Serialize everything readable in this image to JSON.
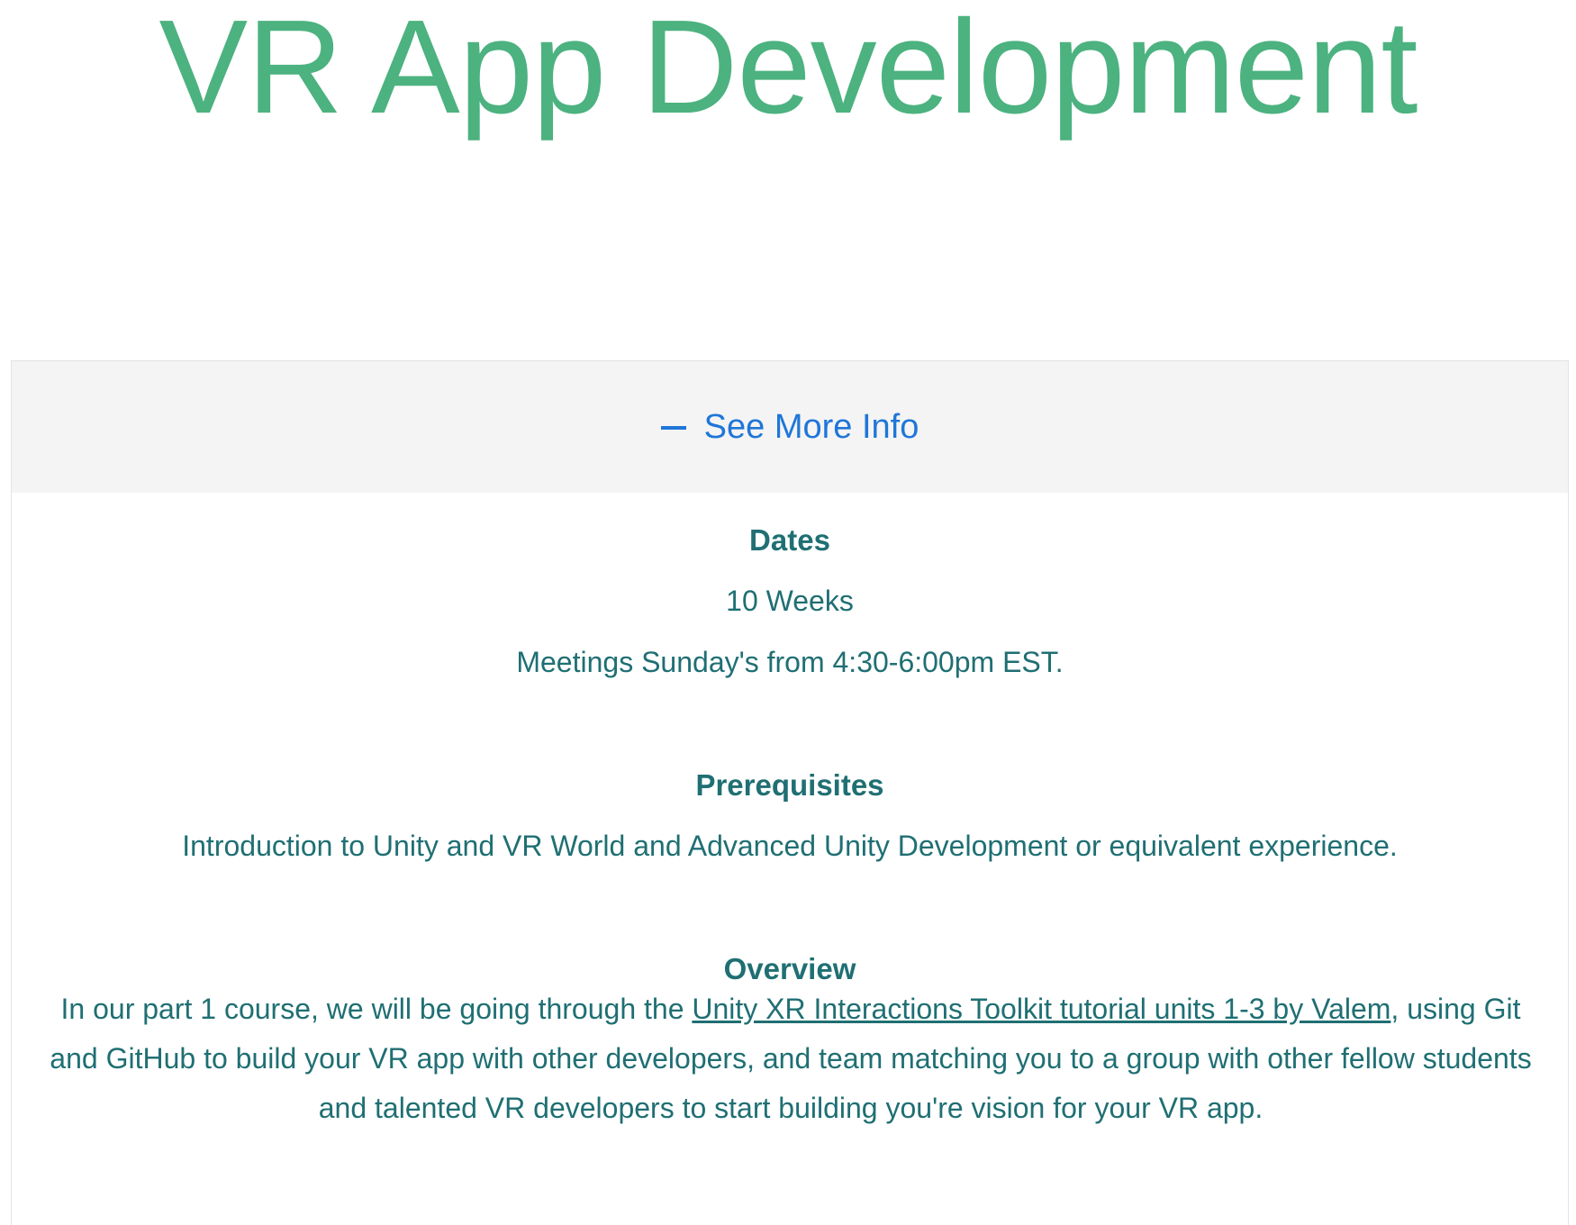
{
  "page": {
    "title": "VR App Development"
  },
  "accordion": {
    "toggle_label": "See More Info",
    "toggle_icon": "minus-icon",
    "sections": {
      "dates": {
        "heading": "Dates",
        "lines": [
          "10 Weeks",
          "Meetings Sunday's from 4:30-6:00pm EST."
        ]
      },
      "prerequisites": {
        "heading": "Prerequisites",
        "text": "Introduction to Unity and VR World and Advanced Unity Development or equivalent experience."
      },
      "overview": {
        "heading": "Overview",
        "text_before_link": "In our part 1 course, we will be going through the ",
        "link_text": "Unity XR Interactions Toolkit tutorial units 1-3 by Valem",
        "text_after_link": ", using Git and GitHub to build your VR app with other developers, and team matching you to a group with other fellow students and talented VR developers to start building you're vision for your VR app."
      }
    }
  },
  "colors": {
    "title": "#4cb27f",
    "accent": "#1f76d8",
    "body_text": "#1f6f73",
    "header_bg": "#f4f4f4"
  }
}
